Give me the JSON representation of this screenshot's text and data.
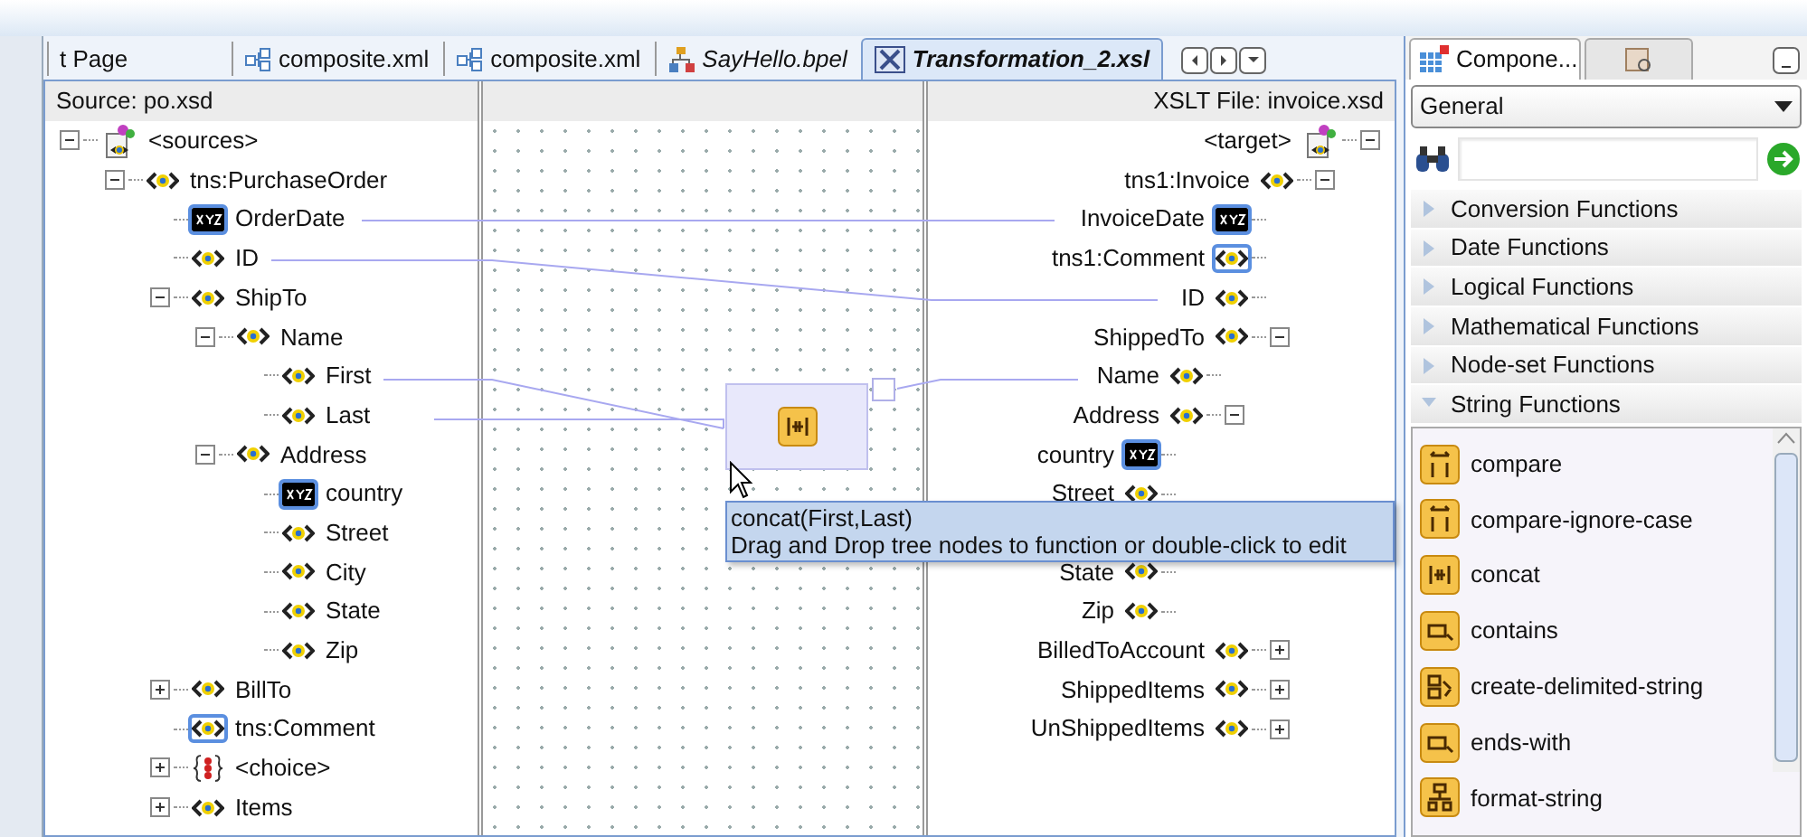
{
  "editor_tabs": [
    {
      "label": "t Page",
      "kind": "plain",
      "selected": false,
      "italic": false
    },
    {
      "label": "composite.xml",
      "kind": "composite",
      "selected": false,
      "italic": false
    },
    {
      "label": "composite.xml",
      "kind": "composite",
      "selected": false,
      "italic": false
    },
    {
      "label": "SayHello.bpel",
      "kind": "bpel",
      "selected": false,
      "italic": true
    },
    {
      "label": "Transformation_2.xsl",
      "kind": "xsl",
      "selected": true,
      "italic": true
    }
  ],
  "source": {
    "title": "Source: po.xsd",
    "tree": [
      {
        "label": "<sources>",
        "kind": "root",
        "expanded": true,
        "highlighted": false,
        "children": [
          {
            "label": "tns:PurchaseOrder",
            "kind": "element",
            "expanded": true,
            "highlighted": false,
            "children": [
              {
                "label": "OrderDate",
                "kind": "text",
                "highlighted": true
              },
              {
                "label": "ID",
                "kind": "element",
                "highlighted": false
              },
              {
                "label": "ShipTo",
                "kind": "element",
                "expanded": true,
                "highlighted": false,
                "children": [
                  {
                    "label": "Name",
                    "kind": "element",
                    "expanded": true,
                    "highlighted": false,
                    "children": [
                      {
                        "label": "First",
                        "kind": "element",
                        "highlighted": false
                      },
                      {
                        "label": "Last",
                        "kind": "element",
                        "highlighted": false
                      }
                    ]
                  },
                  {
                    "label": "Address",
                    "kind": "element",
                    "expanded": true,
                    "highlighted": false,
                    "children": [
                      {
                        "label": "country",
                        "kind": "text",
                        "highlighted": true
                      },
                      {
                        "label": "Street",
                        "kind": "element",
                        "highlighted": false
                      },
                      {
                        "label": "City",
                        "kind": "element",
                        "highlighted": false
                      },
                      {
                        "label": "State",
                        "kind": "element",
                        "highlighted": false
                      },
                      {
                        "label": "Zip",
                        "kind": "element",
                        "highlighted": false
                      }
                    ]
                  }
                ]
              },
              {
                "label": "BillTo",
                "kind": "element",
                "expanded": false,
                "highlighted": false
              },
              {
                "label": "tns:Comment",
                "kind": "element",
                "highlighted": true
              },
              {
                "label": "<choice>",
                "kind": "choice",
                "expanded": false,
                "highlighted": false
              },
              {
                "label": "Items",
                "kind": "element",
                "expanded": false,
                "highlighted": false
              }
            ]
          }
        ]
      }
    ]
  },
  "function_box": {
    "tooltip_title": "concat(First,Last)",
    "tooltip_text": "Drag and Drop tree nodes to function or double-click to edit"
  },
  "target": {
    "title": "XSLT File: invoice.xsd",
    "tree": [
      {
        "label": "<target>",
        "kind": "root",
        "expanded": true,
        "highlighted": false,
        "children": [
          {
            "label": "tns1:Invoice",
            "kind": "element",
            "expanded": true,
            "highlighted": false,
            "children": [
              {
                "label": "InvoiceDate",
                "kind": "text",
                "highlighted": true
              },
              {
                "label": "tns1:Comment",
                "kind": "element",
                "highlighted": true
              },
              {
                "label": "ID",
                "kind": "element",
                "highlighted": false
              },
              {
                "label": "ShippedTo",
                "kind": "element",
                "expanded": true,
                "highlighted": false,
                "children": [
                  {
                    "label": "Name",
                    "kind": "element",
                    "highlighted": false
                  },
                  {
                    "label": "Address",
                    "kind": "element",
                    "expanded": true,
                    "highlighted": false,
                    "children": [
                      {
                        "label": "country",
                        "kind": "text",
                        "highlighted": true
                      },
                      {
                        "label": "Street",
                        "kind": "element",
                        "highlighted": false
                      },
                      {
                        "kind": "covered"
                      },
                      {
                        "label": "State",
                        "kind": "element",
                        "highlighted": false
                      },
                      {
                        "label": "Zip",
                        "kind": "element",
                        "highlighted": false
                      }
                    ]
                  }
                ]
              },
              {
                "label": "BilledToAccount",
                "kind": "element",
                "expanded": false,
                "highlighted": false
              },
              {
                "label": "ShippedItems",
                "kind": "element",
                "expanded": false,
                "highlighted": false
              },
              {
                "label": "UnShippedItems",
                "kind": "element",
                "expanded": false,
                "highlighted": false
              }
            ]
          }
        ]
      }
    ]
  },
  "palette": {
    "tabs": [
      {
        "label": "Compone...",
        "kind": "components",
        "selected": true
      },
      {
        "kind": "resources",
        "selected": false
      }
    ],
    "category_dropdown": "General",
    "categories": [
      {
        "label": "Conversion Functions",
        "expanded": false
      },
      {
        "label": "Date Functions",
        "expanded": false
      },
      {
        "label": "Logical Functions",
        "expanded": false
      },
      {
        "label": "Mathematical Functions",
        "expanded": false
      },
      {
        "label": "Node-set Functions",
        "expanded": false
      },
      {
        "label": "String Functions",
        "expanded": true
      }
    ],
    "functions": [
      {
        "label": "compare",
        "kind": "compare"
      },
      {
        "label": "compare-ignore-case",
        "kind": "compare"
      },
      {
        "label": "concat",
        "kind": "concat"
      },
      {
        "label": "contains",
        "kind": "contains"
      },
      {
        "label": "create-delimited-string",
        "kind": "delimited"
      },
      {
        "label": "ends-with",
        "kind": "contains"
      },
      {
        "label": "format-string",
        "kind": "format"
      }
    ]
  }
}
